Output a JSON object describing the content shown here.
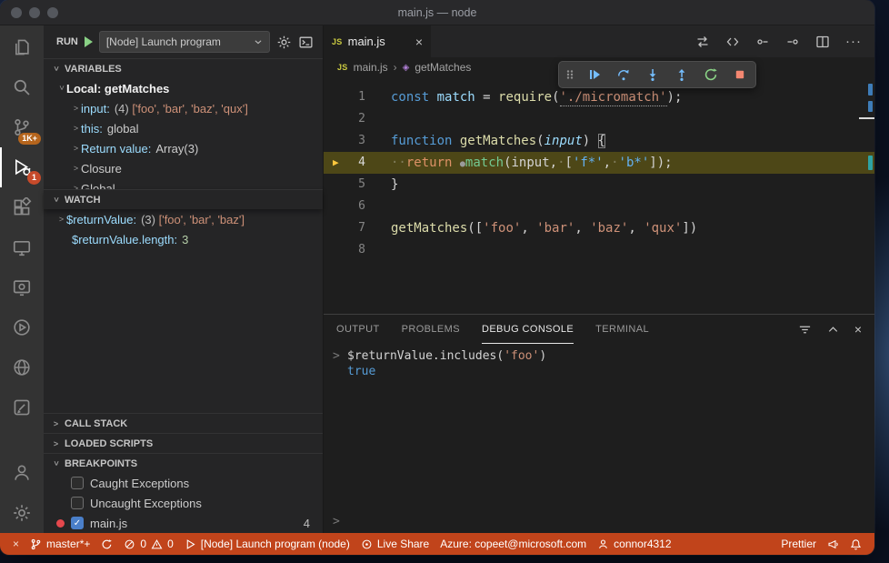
{
  "window": {
    "title": "main.js — node"
  },
  "colors": {
    "statusbar_debug_bg": "#C1441B",
    "current_line_highlight": "#5D5620",
    "badge_orange": "#B5651D",
    "breakpoint_red": "#E5484D",
    "debug_blue": "#75BEFF",
    "restart_green": "#89D185",
    "stop_red": "#F48771"
  },
  "icons": {
    "glyphs": {
      "chevron": ">",
      "close": "×",
      "more": "···",
      "check": "✓",
      "js_badge": "JS",
      "breadcrumb_separator": "›",
      "symbol_method": "◈",
      "prompt": ">",
      "step_arrow": "▶",
      "remote": "×"
    },
    "svg_shapes": [
      "files-icon",
      "search-icon",
      "source-control-icon",
      "run-debug-icon",
      "extensions-icon",
      "remote-explorer-icon",
      "monitor-icon",
      "play-circle-icon",
      "globe-icon",
      "edit-box-icon",
      "accounts-icon",
      "settings-gear-icon",
      "play-button-icon",
      "gear-icon",
      "open-console-icon",
      "drag-handle-icon",
      "continue-icon",
      "step-over-icon",
      "step-into-icon",
      "step-out-icon",
      "restart-icon",
      "stop-icon",
      "swap-icon",
      "code-chevrons-icon",
      "prev-change-icon",
      "next-change-icon",
      "split-editor-icon",
      "filter-icon",
      "collapse-panel-icon",
      "branch-icon",
      "sync-icon",
      "error-icon",
      "warning-icon",
      "play-outline-icon",
      "live-share-icon",
      "account-icon",
      "megaphone-icon",
      "bell-icon",
      "dropdown-chevron-icon"
    ]
  },
  "activity_bar": {
    "scm_badge": "1K+",
    "debug_badge": "1"
  },
  "sidebar": {
    "run_label": "RUN",
    "config_label": "[Node] Launch program",
    "sections": {
      "variables": "VARIABLES",
      "watch": "WATCH",
      "call_stack": "CALL STACK",
      "loaded_scripts": "LOADED SCRIPTS",
      "breakpoints": "BREAKPOINTS"
    },
    "variables": {
      "scope": "Local: getMatches",
      "rows": [
        {
          "name": "input:",
          "count": "(4) ",
          "value": "['foo', 'bar', 'baz', 'qux']"
        },
        {
          "name": "this:",
          "count": "",
          "value": "global"
        },
        {
          "name": "Return value:",
          "count": "",
          "value": "Array(3)"
        }
      ],
      "closure": "Closure",
      "global": "Global"
    },
    "watch": {
      "rows": [
        {
          "name": "$returnValue:",
          "count": "(3) ",
          "value": "['foo', 'bar', 'baz']"
        },
        {
          "name": "$returnValue.length:",
          "count": "",
          "value": "3"
        }
      ]
    },
    "breakpoints": {
      "items": [
        {
          "label": "Caught Exceptions"
        },
        {
          "label": "Uncaught Exceptions"
        },
        {
          "label": "main.js",
          "count": "4"
        }
      ]
    }
  },
  "editor": {
    "tab_label": "main.js",
    "breadcrumb_file": "main.js",
    "breadcrumb_symbol": "getMatches",
    "line_numbers": [
      "1",
      "2",
      "3",
      "4",
      "5",
      "6",
      "7",
      "8"
    ],
    "code": {
      "l1": [
        "const",
        " ",
        "match",
        " = ",
        "require",
        "(",
        "'./micromatch'",
        ");"
      ],
      "l3": [
        "function",
        " ",
        "getMatches",
        "(",
        "input",
        ") ",
        "{"
      ],
      "l4": [
        "··",
        "return",
        " ",
        "●",
        "match",
        "(input,",
        "·",
        "[",
        "'f*'",
        ",",
        "·",
        "'b*'",
        "]);"
      ],
      "l5": [
        "}"
      ],
      "l7": [
        "getMatches",
        "([",
        "'foo'",
        ", ",
        "'bar'",
        ", ",
        "'baz'",
        ", ",
        "'qux'",
        "])"
      ]
    }
  },
  "panel": {
    "tabs": [
      "OUTPUT",
      "PROBLEMS",
      "DEBUG CONSOLE",
      "TERMINAL"
    ],
    "console": {
      "expr_pre": "$returnValue.includes(",
      "expr_str": "'foo'",
      "expr_post": ")",
      "result": "true"
    }
  },
  "status_bar": {
    "branch": "master*+",
    "errors": "0",
    "warnings": "0",
    "launch": "[Node] Launch program (node)",
    "live_share": "Live Share",
    "azure": "Azure: copeet@microsoft.com",
    "account": "connor4312",
    "formatter": "Prettier"
  }
}
